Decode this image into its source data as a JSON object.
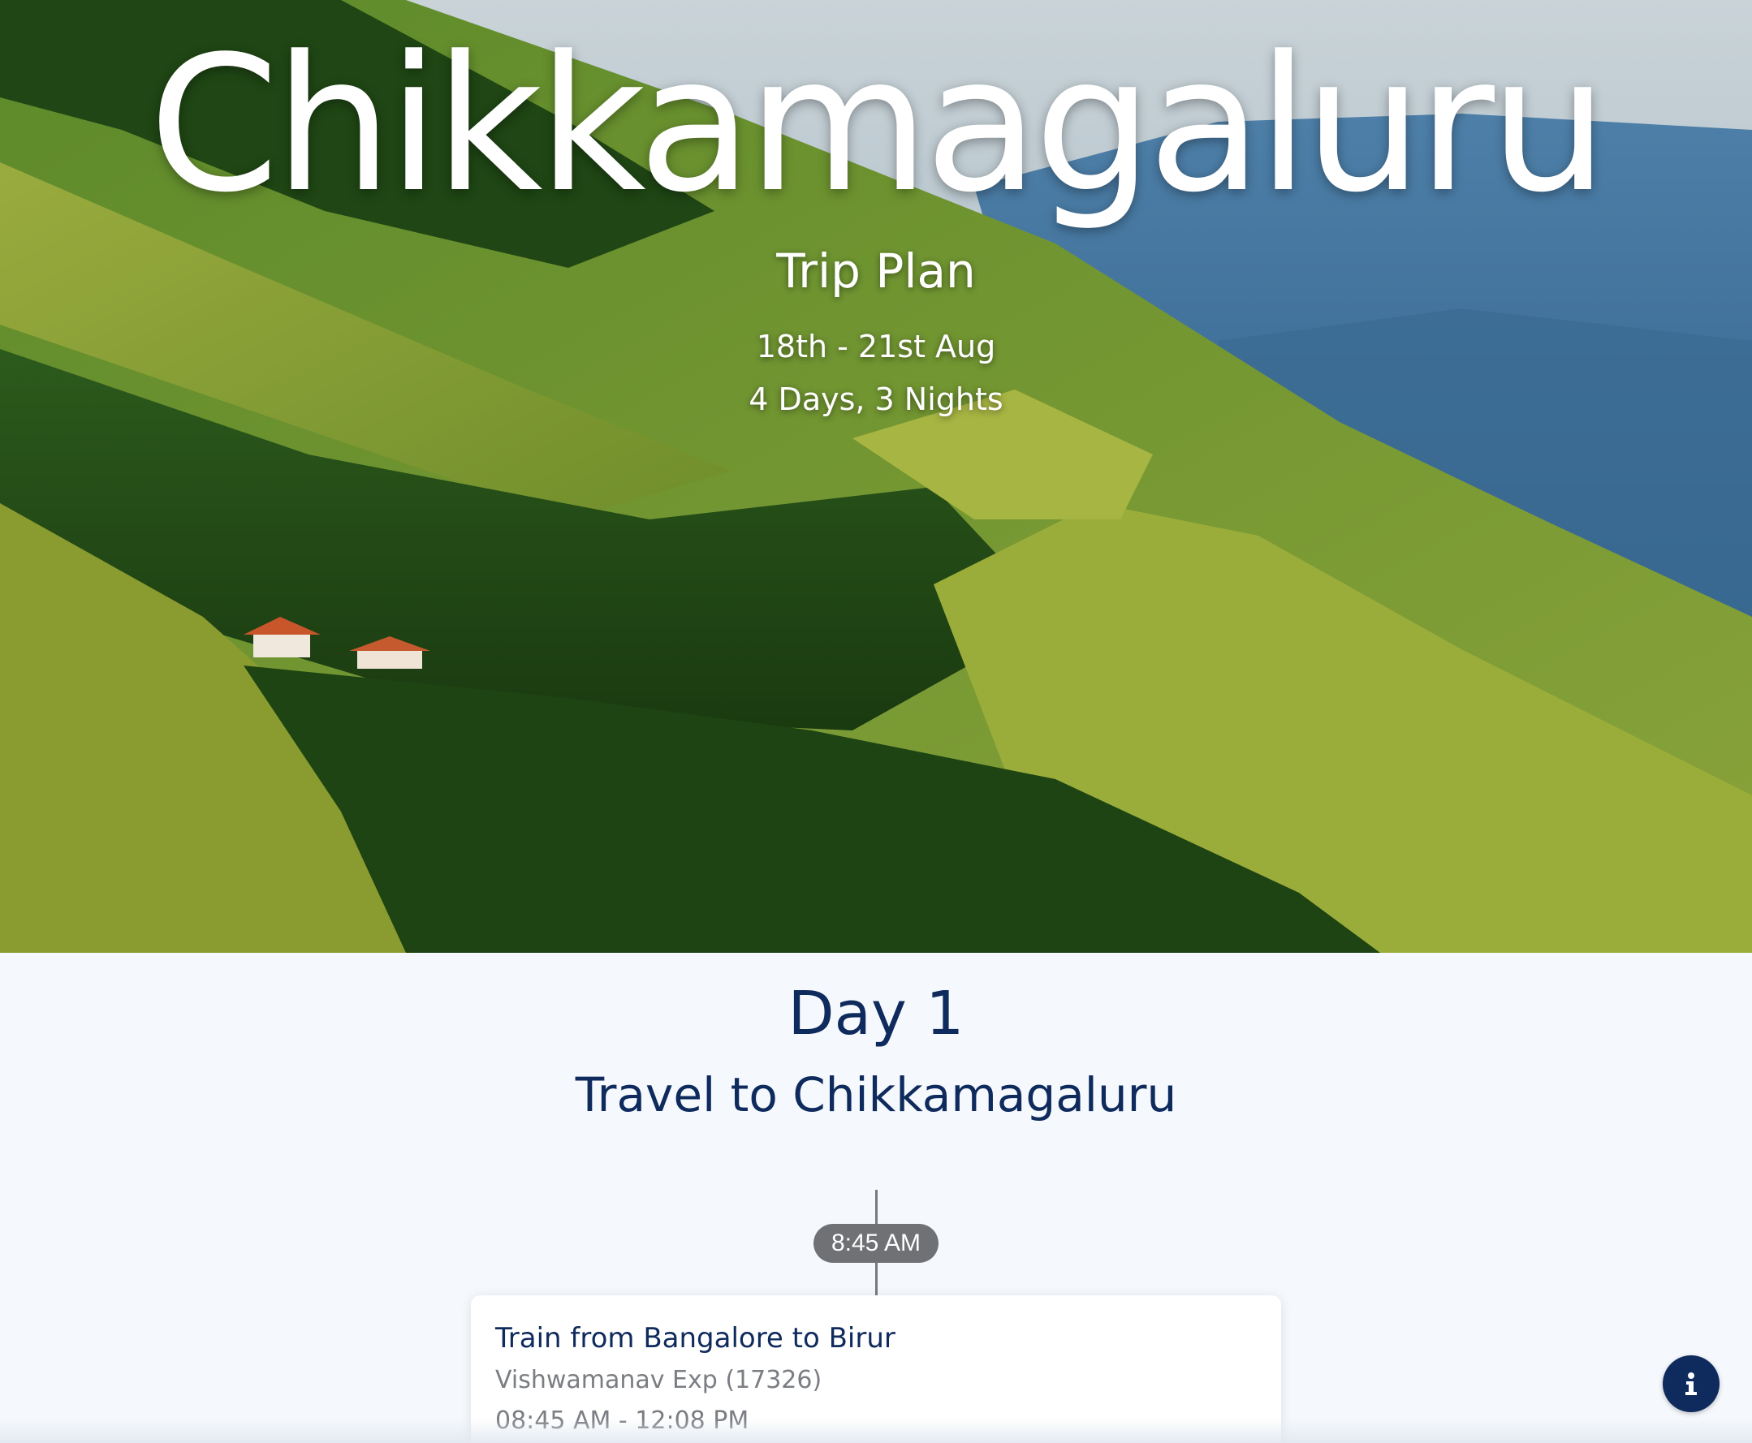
{
  "hero": {
    "title": "Chikkamagaluru",
    "subtitle": "Trip Plan",
    "dates": "18th - 21st Aug",
    "duration": "4 Days, 3 Nights"
  },
  "day": {
    "number_label": "Day 1",
    "title": "Travel to Chikkamagaluru",
    "events": [
      {
        "time": "8:45 AM",
        "title": "Train from Bangalore to Birur",
        "detail": "Vishwamanav Exp (17326)",
        "time_range": "08:45 AM - 12:08 PM"
      }
    ]
  },
  "info_button": {
    "icon": "info-icon"
  },
  "colors": {
    "navy": "#0f2a5c",
    "pill_gray": "#707175",
    "background": "#f5f9fd"
  }
}
